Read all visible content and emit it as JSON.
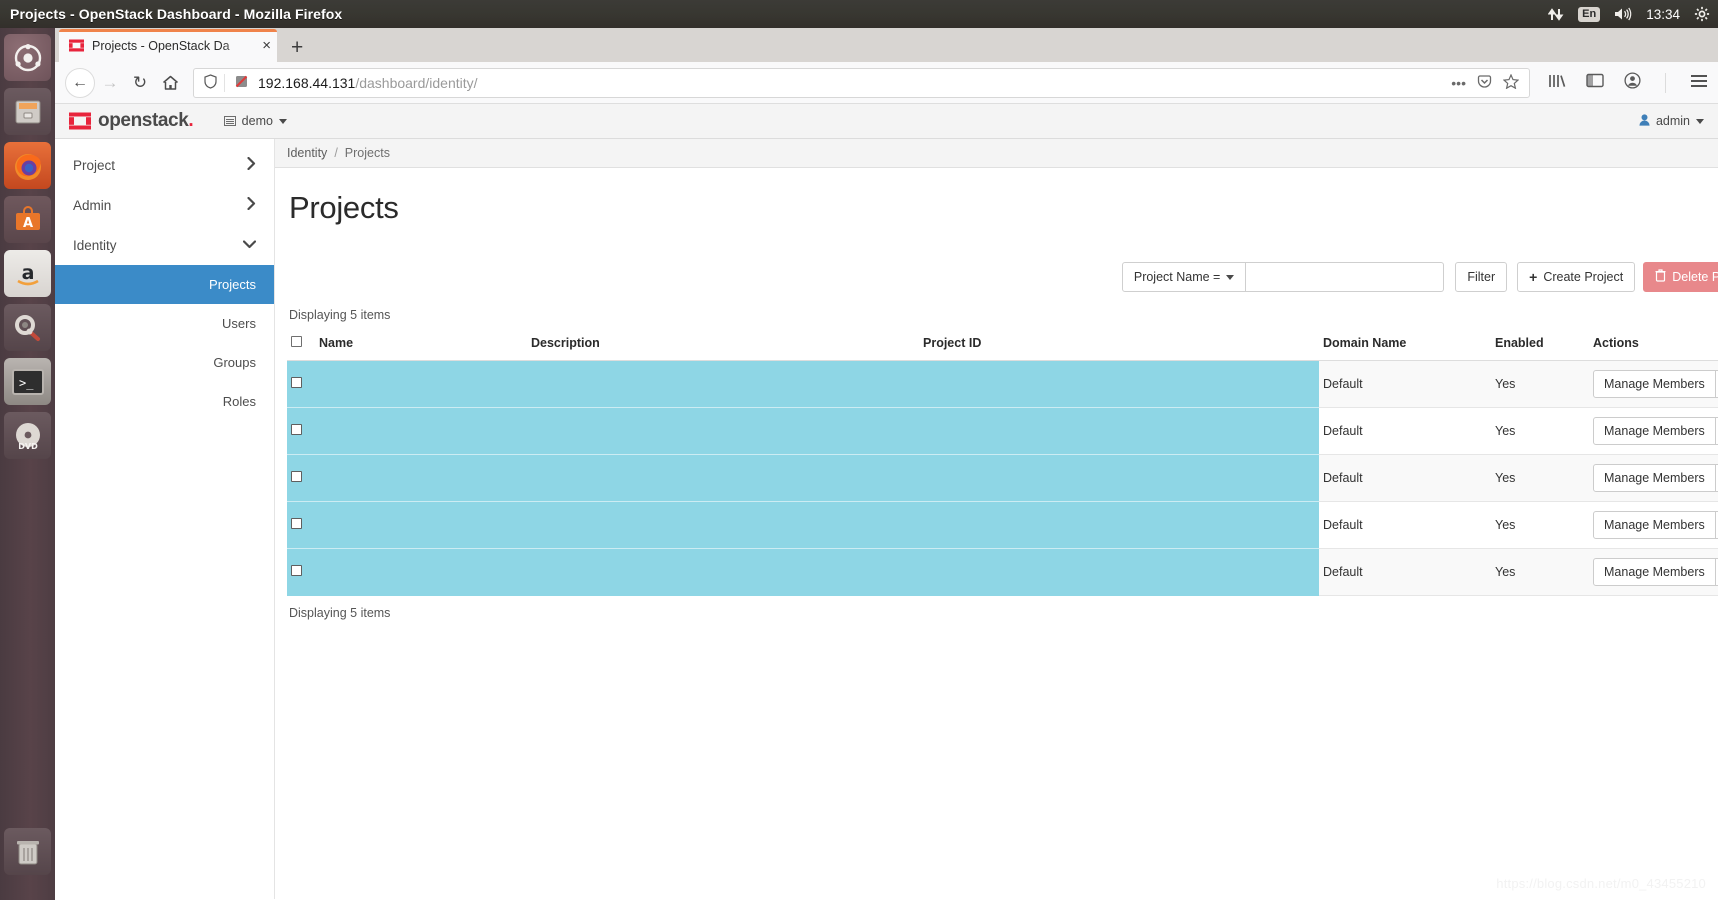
{
  "desktop": {
    "window_title": "Projects - OpenStack Dashboard - Mozilla Firefox",
    "tray": {
      "network_icon": "network-updown-icon",
      "keyboard_layout": "En",
      "volume_icon": "volume-icon",
      "clock": "13:34",
      "settings_icon": "gear-icon"
    },
    "launcher": [
      {
        "name": "ubuntu-dash",
        "label": "Ubuntu Dash"
      },
      {
        "name": "files",
        "label": "Files"
      },
      {
        "name": "firefox",
        "label": "Firefox"
      },
      {
        "name": "ubuntu-software",
        "label": "Ubuntu Software"
      },
      {
        "name": "amazon",
        "label": "Amazon"
      },
      {
        "name": "system-settings",
        "label": "System Settings"
      },
      {
        "name": "terminal",
        "label": "Terminal"
      },
      {
        "name": "dvd",
        "label": "DVD"
      }
    ],
    "trash_label": "Trash"
  },
  "browser": {
    "tab": {
      "title": "Projects - OpenStack Da",
      "close_label": "×"
    },
    "new_tab_label": "+",
    "nav": {
      "back": "←",
      "forward": "→",
      "reload": "↻",
      "home": "⌂"
    },
    "url": {
      "host": "192.168.44.131",
      "path": "/dashboard/identity/"
    },
    "urlbar_actions": {
      "more": "•••",
      "pocket": "pocket-icon",
      "bookmark": "star-icon"
    },
    "toolbar_icons": {
      "library": "library-icon",
      "sidebar": "sidebar-icon",
      "account": "account-icon",
      "menu": "hamburger-menu-icon"
    }
  },
  "header": {
    "brand": "openstack",
    "brand_dot": ".",
    "project_selector": "demo",
    "user": "admin"
  },
  "sidebar": {
    "groups": [
      {
        "label": "Project",
        "icon": "chevron-right-icon",
        "expanded": false
      },
      {
        "label": "Admin",
        "icon": "chevron-right-icon",
        "expanded": false
      },
      {
        "label": "Identity",
        "icon": "chevron-down-icon",
        "expanded": true
      }
    ],
    "identity_items": [
      {
        "label": "Projects",
        "active": true
      },
      {
        "label": "Users",
        "active": false
      },
      {
        "label": "Groups",
        "active": false
      },
      {
        "label": "Roles",
        "active": false
      }
    ]
  },
  "breadcrumb": {
    "parent": "Identity",
    "separator": "/",
    "current": "Projects"
  },
  "page": {
    "title": "Projects",
    "count_top": "Displaying 5 items",
    "count_bottom": "Displaying 5 items"
  },
  "toolbar": {
    "filter_select": "Project Name =",
    "filter_input_value": "",
    "filter_input_placeholder": "",
    "filter_button": "Filter",
    "create_button": "Create Project",
    "create_icon": "plus-icon",
    "delete_button": "Delete Projects",
    "delete_icon": "trash-icon",
    "delete_color": "#e8888b"
  },
  "table": {
    "columns": [
      "Name",
      "Description",
      "Project ID",
      "Domain Name",
      "Enabled",
      "Actions"
    ],
    "select_all": false,
    "action_primary": "Manage Members",
    "action_caret": "chevron-down-icon",
    "rows": [
      {
        "checked": false,
        "name": "",
        "description": "",
        "project_id": "",
        "domain_name": "Default",
        "enabled": "Yes"
      },
      {
        "checked": false,
        "name": "",
        "description": "",
        "project_id": "",
        "domain_name": "Default",
        "enabled": "Yes"
      },
      {
        "checked": false,
        "name": "",
        "description": "",
        "project_id": "",
        "domain_name": "Default",
        "enabled": "Yes"
      },
      {
        "checked": false,
        "name": "",
        "description": "",
        "project_id": "",
        "domain_name": "Default",
        "enabled": "Yes"
      },
      {
        "checked": false,
        "name": "",
        "description": "",
        "project_id": "",
        "domain_name": "Default",
        "enabled": "Yes"
      }
    ],
    "redaction_color": "#8ed6e5"
  },
  "watermark": "https://blog.csdn.net/m0_43455210"
}
